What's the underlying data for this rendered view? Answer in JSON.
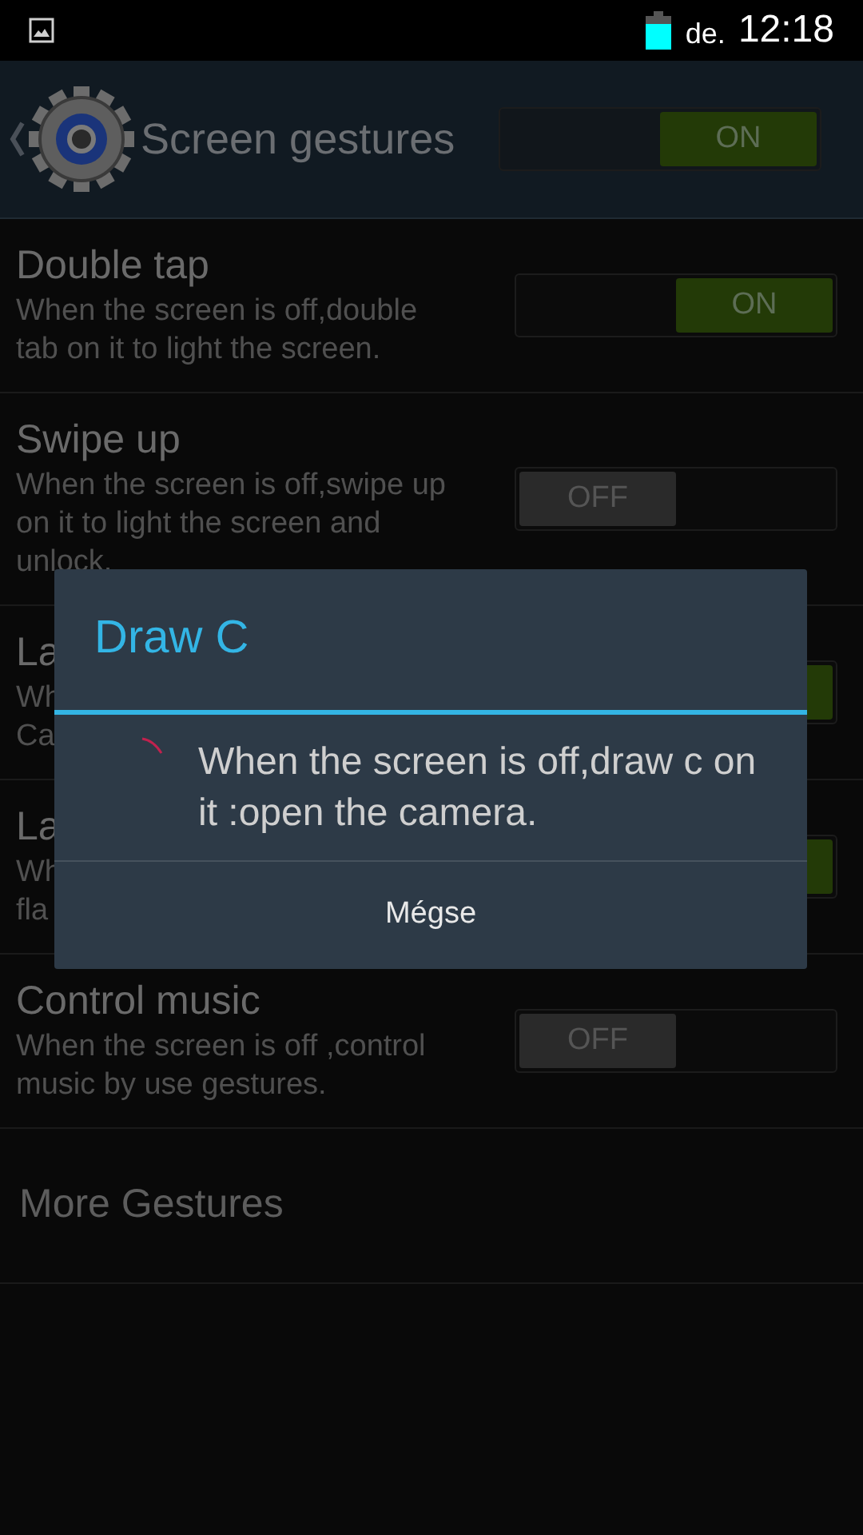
{
  "status_bar": {
    "day": "de.",
    "time": "12:18"
  },
  "header": {
    "title": "Screen gestures",
    "switch": {
      "on": true,
      "label": "ON"
    }
  },
  "gestures": [
    {
      "title": "Double tap",
      "description": [
        "When the screen is off,double",
        "tab on it to light the screen."
      ],
      "on": true,
      "label": "ON"
    },
    {
      "title": "Swipe up",
      "description": [
        "When the screen is off,swipe up",
        "on it to light the screen and",
        "unlock."
      ],
      "on": false,
      "label": "OFF"
    },
    {
      "title": "La",
      "description": [
        "Wh",
        "Ca"
      ],
      "on": true
    },
    {
      "title": "La",
      "description": [
        "Wh",
        "fla"
      ],
      "on": true
    },
    {
      "title": "Control music",
      "description": [
        "When the screen is off ,control",
        "music by use gestures."
      ],
      "on": false,
      "label": "OFF"
    }
  ],
  "more": {
    "label": "More Gestures"
  },
  "dialog": {
    "title": "Draw C",
    "message": "When the screen is off,draw c on it :open the camera.",
    "button": "Mégse"
  }
}
